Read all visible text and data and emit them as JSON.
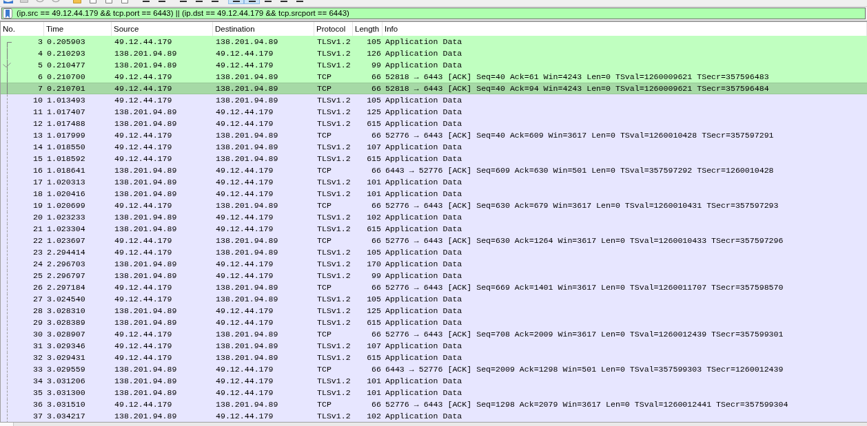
{
  "toolbar": {
    "buttons": [
      {
        "on": false
      },
      {
        "on": false
      },
      {
        "on": false
      },
      {
        "on": false
      },
      {
        "on": false
      },
      {
        "on": false
      },
      {
        "on": false
      },
      {
        "on": false
      },
      {
        "on": false
      },
      {
        "on": false
      },
      {
        "on": false
      },
      {
        "on": false
      },
      {
        "on": false
      },
      {
        "on": true
      },
      {
        "on": true
      },
      {
        "on": false
      },
      {
        "on": false
      },
      {
        "on": false
      }
    ]
  },
  "display_filter": {
    "value": "(ip.src == 49.12.44.179 && tcp.port == 6443) || (ip.dst == 49.12.44.179 && tcp.srcport == 6443)",
    "valid": true
  },
  "packet_list": {
    "columns": [
      "No.",
      "Time",
      "Source",
      "Destination",
      "Protocol",
      "Length",
      "Info"
    ],
    "rows": [
      {
        "no": "3",
        "time": "0.205903",
        "source": "49.12.44.179",
        "destination": "138.201.94.89",
        "protocol": "TLSv1.2",
        "length": "105",
        "info": "Application Data",
        "color": "#c0ffc0",
        "selected": false,
        "related": true,
        "first": true,
        "acked": false
      },
      {
        "no": "4",
        "time": "0.210293",
        "source": "138.201.94.89",
        "destination": "49.12.44.179",
        "protocol": "TLSv1.2",
        "length": "126",
        "info": "Application Data",
        "color": "#c0ffc0",
        "selected": false,
        "related": true,
        "first": false,
        "acked": false
      },
      {
        "no": "5",
        "time": "0.210477",
        "source": "138.201.94.89",
        "destination": "49.12.44.179",
        "protocol": "TLSv1.2",
        "length": "99",
        "info": "Application Data",
        "color": "#c0ffc0",
        "selected": false,
        "related": true,
        "first": false,
        "acked": true
      },
      {
        "no": "6",
        "time": "0.210700",
        "source": "49.12.44.179",
        "destination": "138.201.94.89",
        "protocol": "TCP",
        "length": "66",
        "info": "52818 → 6443 [ACK] Seq=40 Ack=61 Win=4243 Len=0 TSval=1260009621 TSecr=357596483",
        "color": "#c0ffc0",
        "selected": false,
        "related": true,
        "first": false,
        "acked": false
      },
      {
        "no": "7",
        "time": "0.210701",
        "source": "49.12.44.179",
        "destination": "138.201.94.89",
        "protocol": "TCP",
        "length": "66",
        "info": "52818 → 6443 [ACK] Seq=40 Ack=94 Win=4243 Len=0 TSval=1260009621 TSecr=357596484",
        "color": "#a6d9a6",
        "selected": true,
        "related": true,
        "first": false,
        "acked": false
      },
      {
        "no": "10",
        "time": "1.013493",
        "source": "49.12.44.179",
        "destination": "138.201.94.89",
        "protocol": "TLSv1.2",
        "length": "105",
        "info": "Application Data",
        "color": "#e7e6ff",
        "selected": false,
        "related": false,
        "first": false,
        "acked": false
      },
      {
        "no": "11",
        "time": "1.017407",
        "source": "138.201.94.89",
        "destination": "49.12.44.179",
        "protocol": "TLSv1.2",
        "length": "125",
        "info": "Application Data",
        "color": "#e7e6ff",
        "selected": false,
        "related": false,
        "first": false,
        "acked": false
      },
      {
        "no": "12",
        "time": "1.017488",
        "source": "138.201.94.89",
        "destination": "49.12.44.179",
        "protocol": "TLSv1.2",
        "length": "615",
        "info": "Application Data",
        "color": "#e7e6ff",
        "selected": false,
        "related": false,
        "first": false,
        "acked": false
      },
      {
        "no": "13",
        "time": "1.017999",
        "source": "49.12.44.179",
        "destination": "138.201.94.89",
        "protocol": "TCP",
        "length": "66",
        "info": "52776 → 6443 [ACK] Seq=40 Ack=609 Win=3617 Len=0 TSval=1260010428 TSecr=357597291",
        "color": "#e7e6ff",
        "selected": false,
        "related": false,
        "first": false,
        "acked": false
      },
      {
        "no": "14",
        "time": "1.018550",
        "source": "49.12.44.179",
        "destination": "138.201.94.89",
        "protocol": "TLSv1.2",
        "length": "107",
        "info": "Application Data",
        "color": "#e7e6ff",
        "selected": false,
        "related": false,
        "first": false,
        "acked": false
      },
      {
        "no": "15",
        "time": "1.018592",
        "source": "49.12.44.179",
        "destination": "138.201.94.89",
        "protocol": "TLSv1.2",
        "length": "615",
        "info": "Application Data",
        "color": "#e7e6ff",
        "selected": false,
        "related": false,
        "first": false,
        "acked": false
      },
      {
        "no": "16",
        "time": "1.018641",
        "source": "138.201.94.89",
        "destination": "49.12.44.179",
        "protocol": "TCP",
        "length": "66",
        "info": "6443 → 52776 [ACK] Seq=609 Ack=630 Win=501 Len=0 TSval=357597292 TSecr=1260010428",
        "color": "#e7e6ff",
        "selected": false,
        "related": false,
        "first": false,
        "acked": false
      },
      {
        "no": "17",
        "time": "1.020313",
        "source": "138.201.94.89",
        "destination": "49.12.44.179",
        "protocol": "TLSv1.2",
        "length": "101",
        "info": "Application Data",
        "color": "#e7e6ff",
        "selected": false,
        "related": false,
        "first": false,
        "acked": false
      },
      {
        "no": "18",
        "time": "1.020416",
        "source": "138.201.94.89",
        "destination": "49.12.44.179",
        "protocol": "TLSv1.2",
        "length": "101",
        "info": "Application Data",
        "color": "#e7e6ff",
        "selected": false,
        "related": false,
        "first": false,
        "acked": false
      },
      {
        "no": "19",
        "time": "1.020699",
        "source": "49.12.44.179",
        "destination": "138.201.94.89",
        "protocol": "TCP",
        "length": "66",
        "info": "52776 → 6443 [ACK] Seq=630 Ack=679 Win=3617 Len=0 TSval=1260010431 TSecr=357597293",
        "color": "#e7e6ff",
        "selected": false,
        "related": false,
        "first": false,
        "acked": false
      },
      {
        "no": "20",
        "time": "1.023233",
        "source": "138.201.94.89",
        "destination": "49.12.44.179",
        "protocol": "TLSv1.2",
        "length": "102",
        "info": "Application Data",
        "color": "#e7e6ff",
        "selected": false,
        "related": false,
        "first": false,
        "acked": false
      },
      {
        "no": "21",
        "time": "1.023304",
        "source": "138.201.94.89",
        "destination": "49.12.44.179",
        "protocol": "TLSv1.2",
        "length": "615",
        "info": "Application Data",
        "color": "#e7e6ff",
        "selected": false,
        "related": false,
        "first": false,
        "acked": false
      },
      {
        "no": "22",
        "time": "1.023697",
        "source": "49.12.44.179",
        "destination": "138.201.94.89",
        "protocol": "TCP",
        "length": "66",
        "info": "52776 → 6443 [ACK] Seq=630 Ack=1264 Win=3617 Len=0 TSval=1260010433 TSecr=357597296",
        "color": "#e7e6ff",
        "selected": false,
        "related": false,
        "first": false,
        "acked": false
      },
      {
        "no": "23",
        "time": "2.294414",
        "source": "49.12.44.179",
        "destination": "138.201.94.89",
        "protocol": "TLSv1.2",
        "length": "105",
        "info": "Application Data",
        "color": "#e7e6ff",
        "selected": false,
        "related": false,
        "first": false,
        "acked": false
      },
      {
        "no": "24",
        "time": "2.296703",
        "source": "138.201.94.89",
        "destination": "49.12.44.179",
        "protocol": "TLSv1.2",
        "length": "170",
        "info": "Application Data",
        "color": "#e7e6ff",
        "selected": false,
        "related": false,
        "first": false,
        "acked": false
      },
      {
        "no": "25",
        "time": "2.296797",
        "source": "138.201.94.89",
        "destination": "49.12.44.179",
        "protocol": "TLSv1.2",
        "length": "99",
        "info": "Application Data",
        "color": "#e7e6ff",
        "selected": false,
        "related": false,
        "first": false,
        "acked": false
      },
      {
        "no": "26",
        "time": "2.297184",
        "source": "49.12.44.179",
        "destination": "138.201.94.89",
        "protocol": "TCP",
        "length": "66",
        "info": "52776 → 6443 [ACK] Seq=669 Ack=1401 Win=3617 Len=0 TSval=1260011707 TSecr=357598570",
        "color": "#e7e6ff",
        "selected": false,
        "related": false,
        "first": false,
        "acked": false
      },
      {
        "no": "27",
        "time": "3.024540",
        "source": "49.12.44.179",
        "destination": "138.201.94.89",
        "protocol": "TLSv1.2",
        "length": "105",
        "info": "Application Data",
        "color": "#e7e6ff",
        "selected": false,
        "related": false,
        "first": false,
        "acked": false
      },
      {
        "no": "28",
        "time": "3.028310",
        "source": "138.201.94.89",
        "destination": "49.12.44.179",
        "protocol": "TLSv1.2",
        "length": "125",
        "info": "Application Data",
        "color": "#e7e6ff",
        "selected": false,
        "related": false,
        "first": false,
        "acked": false
      },
      {
        "no": "29",
        "time": "3.028389",
        "source": "138.201.94.89",
        "destination": "49.12.44.179",
        "protocol": "TLSv1.2",
        "length": "615",
        "info": "Application Data",
        "color": "#e7e6ff",
        "selected": false,
        "related": false,
        "first": false,
        "acked": false
      },
      {
        "no": "30",
        "time": "3.028907",
        "source": "49.12.44.179",
        "destination": "138.201.94.89",
        "protocol": "TCP",
        "length": "66",
        "info": "52776 → 6443 [ACK] Seq=708 Ack=2009 Win=3617 Len=0 TSval=1260012439 TSecr=357599301",
        "color": "#e7e6ff",
        "selected": false,
        "related": false,
        "first": false,
        "acked": false
      },
      {
        "no": "31",
        "time": "3.029346",
        "source": "49.12.44.179",
        "destination": "138.201.94.89",
        "protocol": "TLSv1.2",
        "length": "107",
        "info": "Application Data",
        "color": "#e7e6ff",
        "selected": false,
        "related": false,
        "first": false,
        "acked": false
      },
      {
        "no": "32",
        "time": "3.029431",
        "source": "49.12.44.179",
        "destination": "138.201.94.89",
        "protocol": "TLSv1.2",
        "length": "615",
        "info": "Application Data",
        "color": "#e7e6ff",
        "selected": false,
        "related": false,
        "first": false,
        "acked": false
      },
      {
        "no": "33",
        "time": "3.029559",
        "source": "138.201.94.89",
        "destination": "49.12.44.179",
        "protocol": "TCP",
        "length": "66",
        "info": "6443 → 52776 [ACK] Seq=2009 Ack=1298 Win=501 Len=0 TSval=357599303 TSecr=1260012439",
        "color": "#e7e6ff",
        "selected": false,
        "related": false,
        "first": false,
        "acked": false
      },
      {
        "no": "34",
        "time": "3.031206",
        "source": "138.201.94.89",
        "destination": "49.12.44.179",
        "protocol": "TLSv1.2",
        "length": "101",
        "info": "Application Data",
        "color": "#e7e6ff",
        "selected": false,
        "related": false,
        "first": false,
        "acked": false
      },
      {
        "no": "35",
        "time": "3.031300",
        "source": "138.201.94.89",
        "destination": "49.12.44.179",
        "protocol": "TLSv1.2",
        "length": "101",
        "info": "Application Data",
        "color": "#e7e6ff",
        "selected": false,
        "related": false,
        "first": false,
        "acked": false
      },
      {
        "no": "36",
        "time": "3.031510",
        "source": "49.12.44.179",
        "destination": "138.201.94.89",
        "protocol": "TCP",
        "length": "66",
        "info": "52776 → 6443 [ACK] Seq=1298 Ack=2079 Win=3617 Len=0 TSval=1260012441 TSecr=357599304",
        "color": "#e7e6ff",
        "selected": false,
        "related": false,
        "first": false,
        "acked": false
      },
      {
        "no": "37",
        "time": "3.034217",
        "source": "138.201.94.89",
        "destination": "49.12.44.179",
        "protocol": "TLSv1.2",
        "length": "102",
        "info": "Application Data",
        "color": "#e7e6ff",
        "selected": false,
        "related": false,
        "first": false,
        "acked": false
      }
    ]
  }
}
